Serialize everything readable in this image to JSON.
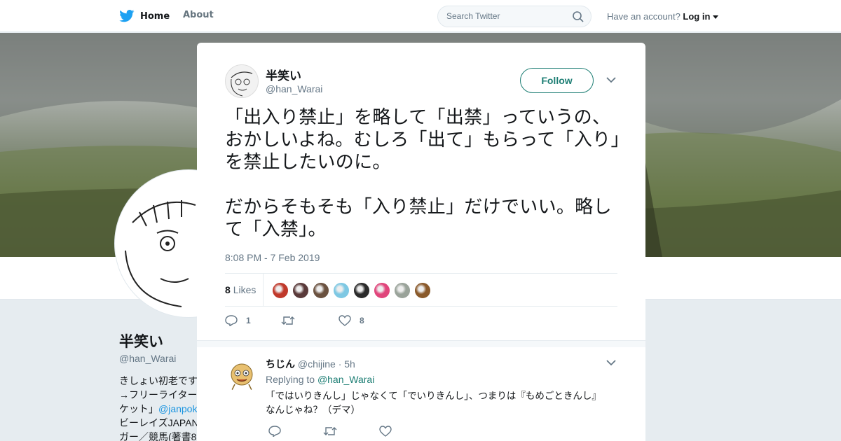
{
  "nav": {
    "home_label": "Home",
    "about_label": "About",
    "search_placeholder": "Search Twitter",
    "account_prompt": "Have an account?",
    "login_label": "Log in"
  },
  "profile": {
    "name": "半笑い",
    "handle": "@han_Warai",
    "bio_lines": [
      "きしょい初老です",
      "→フリーライター",
      "ケット」",
      "ビーレイズJAPAN",
      "ガー／競馬(著書8"
    ],
    "bio_link": "@janpok"
  },
  "tweet": {
    "author_name": "半笑い",
    "author_handle": "@han_Warai",
    "follow_label": "Follow",
    "text": "「出入り禁止」を略して「出禁」っていうの、おかしいよね。むしろ「出て」もらって「入り」を禁止したいのに。\n\nだからそもそも「入り禁止」だけでいい。略して「入禁」。",
    "timestamp": "8:08 PM - 7 Feb 2019",
    "likes_count": "8",
    "likes_label": "Likes",
    "reply_count": "1",
    "retweet_count": "",
    "like_count": "8",
    "liker_colors": [
      "#c0392b",
      "#5a3a3a",
      "#6b5240",
      "#7ec8e3",
      "#2b2b2b",
      "#e0457b",
      "#9aa39a",
      "#8a5a2b"
    ]
  },
  "reply": {
    "author_name": "ちじん",
    "author_handle": "@chijine",
    "age": "· 5h",
    "replying_to_prefix": "Replying to",
    "replying_to_handle": "@han_Warai",
    "text": "「ではいりきんし」じゃなくて「でいりきんし」、つまりは『もめごときんし』なんじゃね？（デマ）"
  },
  "colors": {
    "accent": "#1d7e74",
    "twitter_blue": "#1da1f2",
    "muted": "#657786"
  }
}
